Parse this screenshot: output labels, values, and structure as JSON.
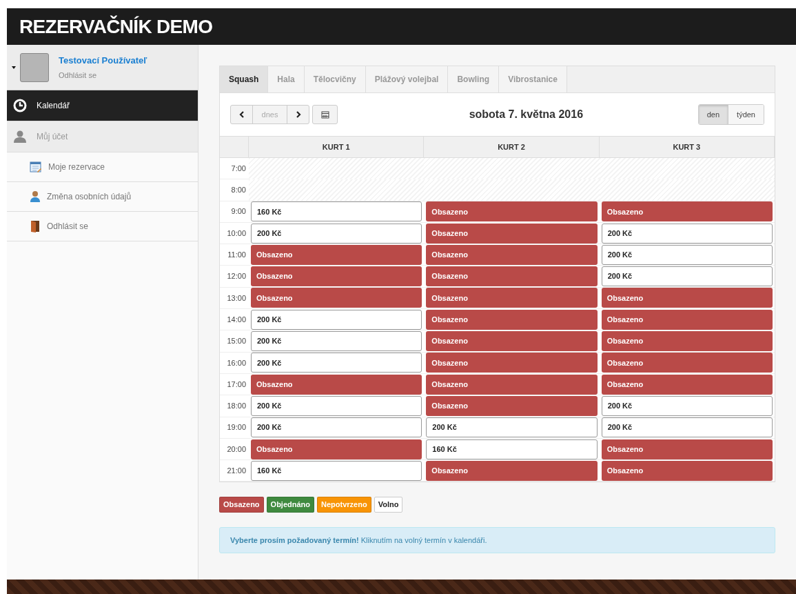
{
  "app_title": "REZERVAČNÍK DEMO",
  "user": {
    "name": "Testovací Používateľ",
    "logout": "Odhlásit se"
  },
  "menu": [
    {
      "label": "Kalendář",
      "kind": "clock",
      "selected": true
    },
    {
      "label": "Můj účet",
      "kind": "user",
      "selected": false
    },
    {
      "label": "Moje rezervace",
      "kind": "calendar",
      "selected": false
    },
    {
      "label": "Změna osobních údajů",
      "kind": "person",
      "selected": false
    },
    {
      "label": "Odhlásit se",
      "kind": "door",
      "selected": false
    }
  ],
  "tabs": [
    {
      "label": "Squash",
      "selected": true
    },
    {
      "label": "Hala",
      "selected": false
    },
    {
      "label": "Tělocvičny",
      "selected": false
    },
    {
      "label": "Plážový volejbal",
      "selected": false
    },
    {
      "label": "Bowling",
      "selected": false
    },
    {
      "label": "Vibrostanice",
      "selected": false
    }
  ],
  "today_button": "dnes",
  "date": "sobota 7. května 2016",
  "views": [
    {
      "label": "den",
      "selected": true
    },
    {
      "label": "týden",
      "selected": false
    }
  ],
  "columns": [
    "KURT 1",
    "KURT 2",
    "KURT 3"
  ],
  "rows": [
    {
      "time": "7:00",
      "slots": [
        {
          "kind": "past"
        },
        {
          "kind": "past"
        },
        {
          "kind": "past"
        }
      ]
    },
    {
      "time": "8:00",
      "slots": [
        {
          "kind": "past"
        },
        {
          "kind": "past"
        },
        {
          "kind": "past"
        }
      ]
    },
    {
      "time": "9:00",
      "slots": [
        {
          "kind": "free",
          "text": "160 Kč"
        },
        {
          "kind": "occupied",
          "text": "Obsazeno"
        },
        {
          "kind": "occupied",
          "text": "Obsazeno"
        }
      ]
    },
    {
      "time": "10:00",
      "slots": [
        {
          "kind": "free",
          "text": "200 Kč"
        },
        {
          "kind": "occupied",
          "text": "Obsazeno"
        },
        {
          "kind": "free",
          "text": "200 Kč"
        }
      ]
    },
    {
      "time": "11:00",
      "slots": [
        {
          "kind": "occupied",
          "text": "Obsazeno"
        },
        {
          "kind": "occupied",
          "text": "Obsazeno"
        },
        {
          "kind": "free",
          "text": "200 Kč"
        }
      ]
    },
    {
      "time": "12:00",
      "slots": [
        {
          "kind": "occupied",
          "text": "Obsazeno"
        },
        {
          "kind": "occupied",
          "text": "Obsazeno"
        },
        {
          "kind": "free",
          "text": "200 Kč"
        }
      ]
    },
    {
      "time": "13:00",
      "slots": [
        {
          "kind": "occupied",
          "text": "Obsazeno"
        },
        {
          "kind": "occupied",
          "text": "Obsazeno"
        },
        {
          "kind": "occupied",
          "text": "Obsazeno"
        }
      ]
    },
    {
      "time": "14:00",
      "slots": [
        {
          "kind": "free",
          "text": "200 Kč"
        },
        {
          "kind": "occupied",
          "text": "Obsazeno"
        },
        {
          "kind": "occupied",
          "text": "Obsazeno"
        }
      ]
    },
    {
      "time": "15:00",
      "slots": [
        {
          "kind": "free",
          "text": "200 Kč"
        },
        {
          "kind": "occupied",
          "text": "Obsazeno"
        },
        {
          "kind": "occupied",
          "text": "Obsazeno"
        }
      ]
    },
    {
      "time": "16:00",
      "slots": [
        {
          "kind": "free",
          "text": "200 Kč"
        },
        {
          "kind": "occupied",
          "text": "Obsazeno"
        },
        {
          "kind": "occupied",
          "text": "Obsazeno"
        }
      ]
    },
    {
      "time": "17:00",
      "slots": [
        {
          "kind": "occupied",
          "text": "Obsazeno"
        },
        {
          "kind": "occupied",
          "text": "Obsazeno"
        },
        {
          "kind": "occupied",
          "text": "Obsazeno"
        }
      ]
    },
    {
      "time": "18:00",
      "slots": [
        {
          "kind": "free",
          "text": "200 Kč"
        },
        {
          "kind": "occupied",
          "text": "Obsazeno"
        },
        {
          "kind": "free",
          "text": "200 Kč"
        }
      ]
    },
    {
      "time": "19:00",
      "slots": [
        {
          "kind": "free",
          "text": "200 Kč"
        },
        {
          "kind": "free",
          "text": "200 Kč"
        },
        {
          "kind": "free",
          "text": "200 Kč"
        }
      ]
    },
    {
      "time": "20:00",
      "slots": [
        {
          "kind": "occupied",
          "text": "Obsazeno"
        },
        {
          "kind": "free",
          "text": "160 Kč"
        },
        {
          "kind": "occupied",
          "text": "Obsazeno"
        }
      ]
    },
    {
      "time": "21:00",
      "slots": [
        {
          "kind": "free",
          "text": "160 Kč"
        },
        {
          "kind": "occupied",
          "text": "Obsazeno"
        },
        {
          "kind": "occupied",
          "text": "Obsazeno"
        }
      ]
    }
  ],
  "legend": [
    {
      "label": "Obsazeno",
      "color": "#b94a48"
    },
    {
      "label": "Objednáno",
      "color": "#3f8a3f"
    },
    {
      "label": "Nepotvrzeno",
      "color": "#f89406"
    },
    {
      "label": "Volno",
      "color": "#ffffff"
    }
  ],
  "alert": "**Vyberte prosím požadovaný termín!** Kliknutím na volný termín v kalendáři."
}
